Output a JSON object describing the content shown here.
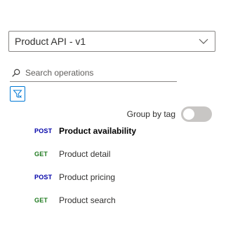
{
  "api_selector": {
    "value": "Product API - v1",
    "icon": "chevron-down-icon"
  },
  "search": {
    "placeholder": "Search operations",
    "value": "",
    "icon": "search-icon"
  },
  "filter": {
    "icon": "filter-icon",
    "accent_color": "#0078d4"
  },
  "group_by_tag": {
    "label": "Group by tag",
    "enabled": false
  },
  "operations": [
    {
      "method": "POST",
      "name": "Product availability",
      "selected": true
    },
    {
      "method": "GET",
      "name": "Product detail",
      "selected": false
    },
    {
      "method": "POST",
      "name": "Product pricing",
      "selected": false
    },
    {
      "method": "GET",
      "name": "Product search",
      "selected": false
    }
  ],
  "colors": {
    "post_method": "#0000a8",
    "get_method": "#1e7a1e",
    "toggle_off": "#c8c6c4",
    "border": "#8a8886"
  }
}
